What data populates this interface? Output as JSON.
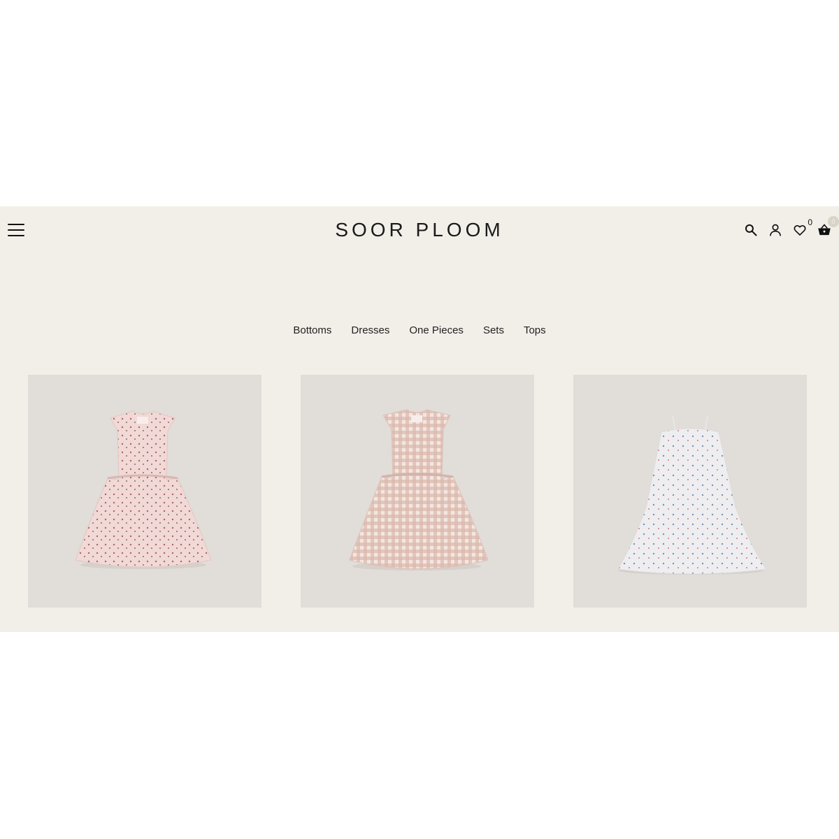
{
  "header": {
    "logo_text": "SOOR PLOOM",
    "wishlist_count": "0",
    "cart_count": "0"
  },
  "icons": {
    "menu": "hamburger-menu-icon",
    "search": "search-icon",
    "account": "user-icon",
    "wishlist": "heart-icon",
    "cart": "basket-icon"
  },
  "category_nav": {
    "items": [
      "Bottoms",
      "Dresses",
      "One Pieces",
      "Sets",
      "Tops"
    ]
  },
  "products": [
    {
      "image": "pink floral pinafore dress",
      "color": "#f0d9d6"
    },
    {
      "image": "pink gingham pinafore dress",
      "color": "#e7cbc4"
    },
    {
      "image": "white floral strappy sundress",
      "color": "#eeeef0"
    }
  ],
  "colors": {
    "background": "#f2efe9",
    "card_background": "#e1ddd8",
    "text": "#1b1b1b"
  }
}
